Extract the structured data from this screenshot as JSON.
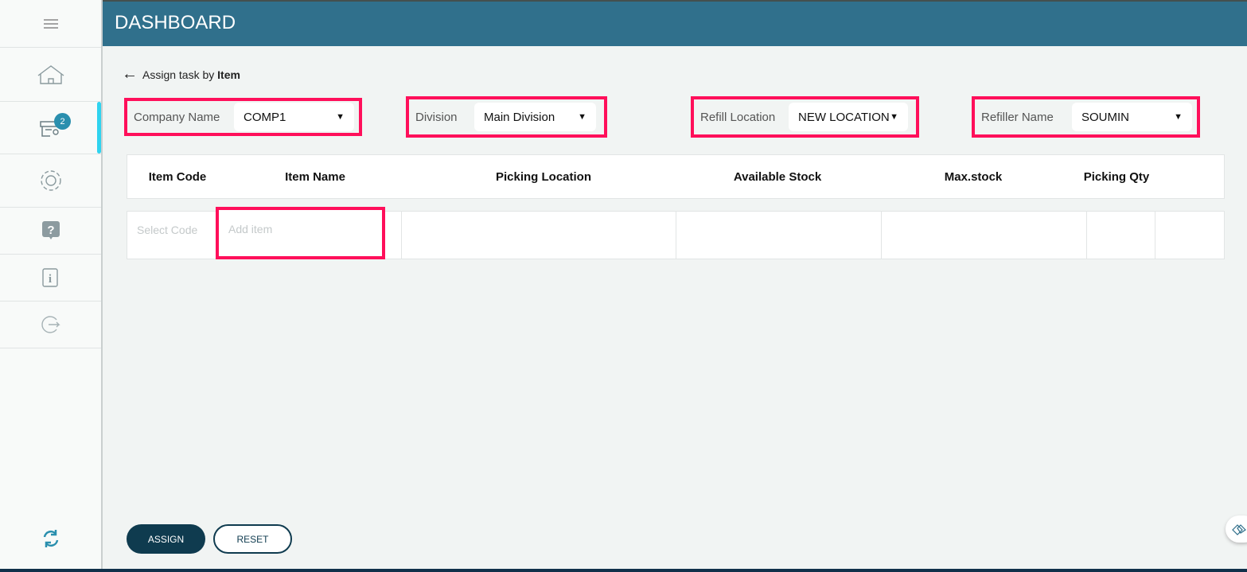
{
  "header": {
    "title": "DASHBOARD"
  },
  "sidebar": {
    "items": [
      {
        "icon": "menu-icon"
      },
      {
        "icon": "home-icon"
      },
      {
        "icon": "tasks-icon",
        "badge": "2"
      },
      {
        "icon": "gear-icon"
      },
      {
        "icon": "help-icon"
      },
      {
        "icon": "info-icon"
      },
      {
        "icon": "logout-icon"
      }
    ],
    "sync_icon": "sync-icon"
  },
  "page": {
    "back_label": "Assign task by ",
    "back_label_bold": "Item"
  },
  "filters": [
    {
      "label": "Company Name",
      "value": "COMP1"
    },
    {
      "label": "Division",
      "value": "Main Division"
    },
    {
      "label": "Refill Location",
      "value": "NEW LOCATION"
    },
    {
      "label": "Refiller Name",
      "value": "SOUMIN"
    }
  ],
  "table": {
    "columns": [
      "Item Code",
      "Item Name",
      "Picking Location",
      "Available Stock",
      "Max.stock",
      "Picking Qty"
    ],
    "row": {
      "code_placeholder": "Select Code",
      "item_placeholder": "Add item"
    }
  },
  "actions": {
    "assign": "ASSIGN",
    "reset": "RESET"
  },
  "colors": {
    "header": "#30708c",
    "highlight": "#ff0f5a",
    "assign": "#0f3b4f"
  }
}
